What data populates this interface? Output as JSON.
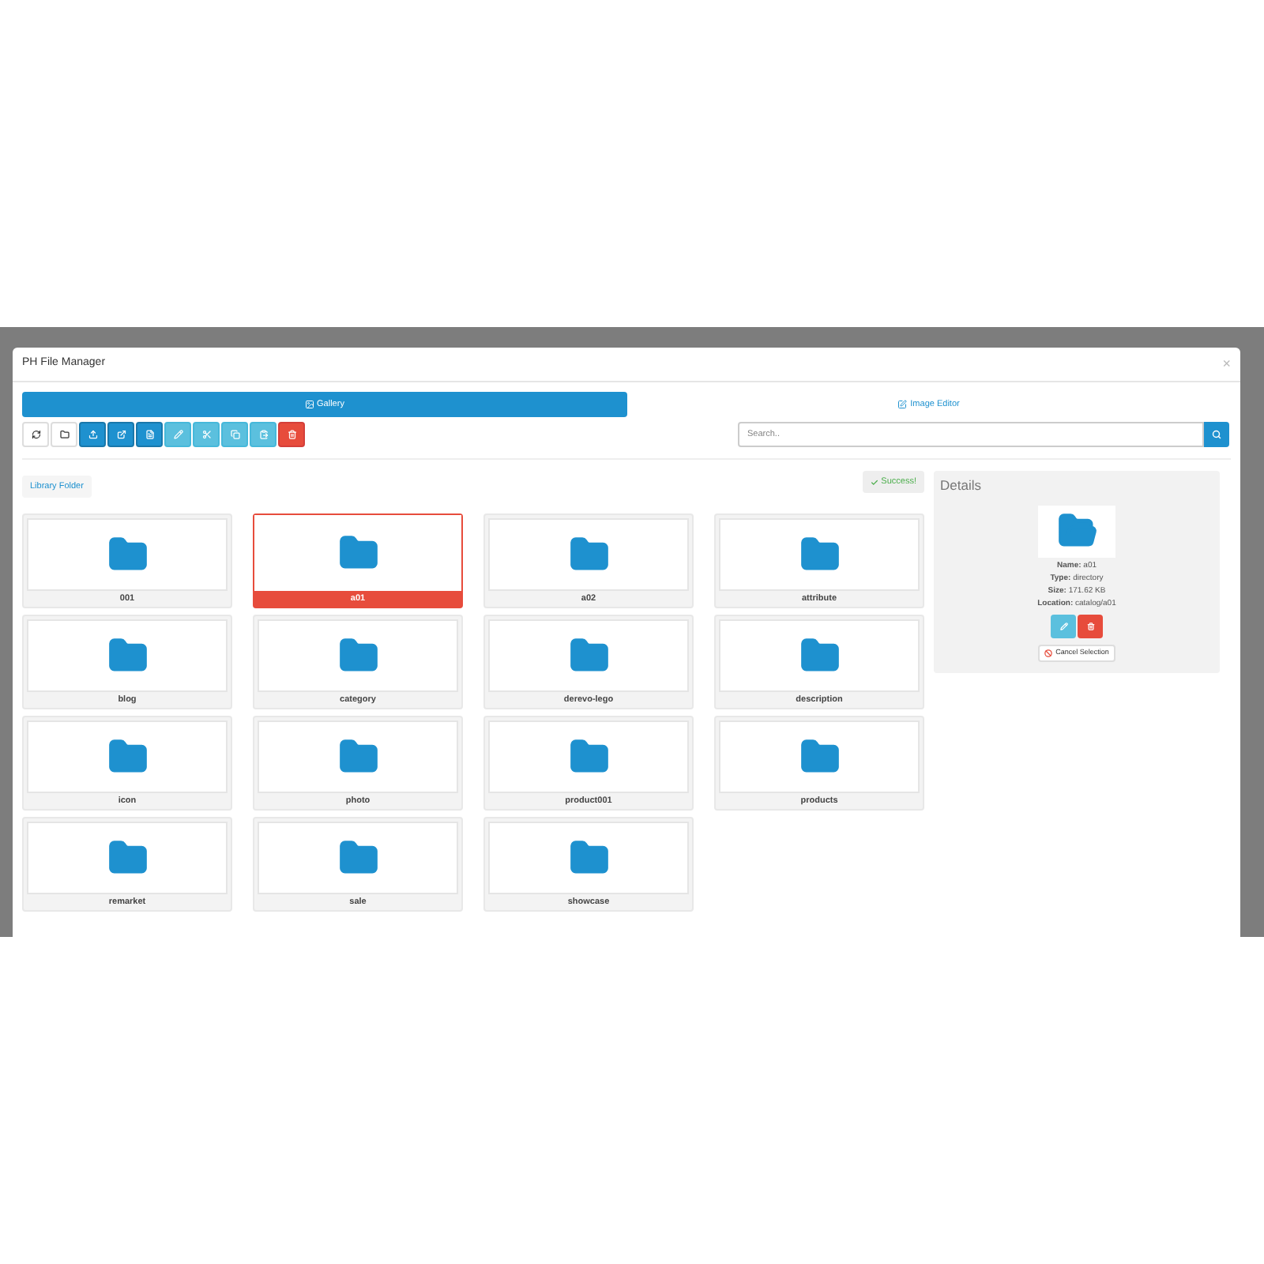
{
  "modal": {
    "title": "PH File Manager",
    "close": "×"
  },
  "tabs": [
    {
      "label": "Gallery",
      "selected": true
    },
    {
      "label": "Image Editor",
      "selected": false
    }
  ],
  "toolbar": [
    {
      "kind": "default"
    },
    {
      "kind": "default"
    },
    {
      "kind": "primary"
    },
    {
      "kind": "primary"
    },
    {
      "kind": "primary"
    },
    {
      "kind": "info"
    },
    {
      "kind": "info"
    },
    {
      "kind": "info"
    },
    {
      "kind": "info"
    },
    {
      "kind": "danger"
    }
  ],
  "search": {
    "placeholder": "Search.."
  },
  "breadcrumb": "Library Folder",
  "alert": "Success!",
  "folders": [
    {
      "name": "001",
      "selected": false
    },
    {
      "name": "a01",
      "selected": true
    },
    {
      "name": "a02",
      "selected": false
    },
    {
      "name": "attribute",
      "selected": false
    },
    {
      "name": "blog",
      "selected": false
    },
    {
      "name": "category",
      "selected": false
    },
    {
      "name": "derevo-lego",
      "selected": false
    },
    {
      "name": "description",
      "selected": false
    },
    {
      "name": "icon",
      "selected": false
    },
    {
      "name": "photo",
      "selected": false
    },
    {
      "name": "product001",
      "selected": false
    },
    {
      "name": "products",
      "selected": false
    },
    {
      "name": "remarket",
      "selected": false
    },
    {
      "name": "sale",
      "selected": false
    },
    {
      "name": "showcase",
      "selected": false
    }
  ],
  "details": {
    "title": "Details",
    "fields": [
      {
        "label": "Name:",
        "value": "a01"
      },
      {
        "label": "Type:",
        "value": "directory"
      },
      {
        "label": "Size:",
        "value": "171.62 KB"
      },
      {
        "label": "Location:",
        "value": "catalog/a01"
      }
    ],
    "cancel": "Cancel Selection"
  }
}
